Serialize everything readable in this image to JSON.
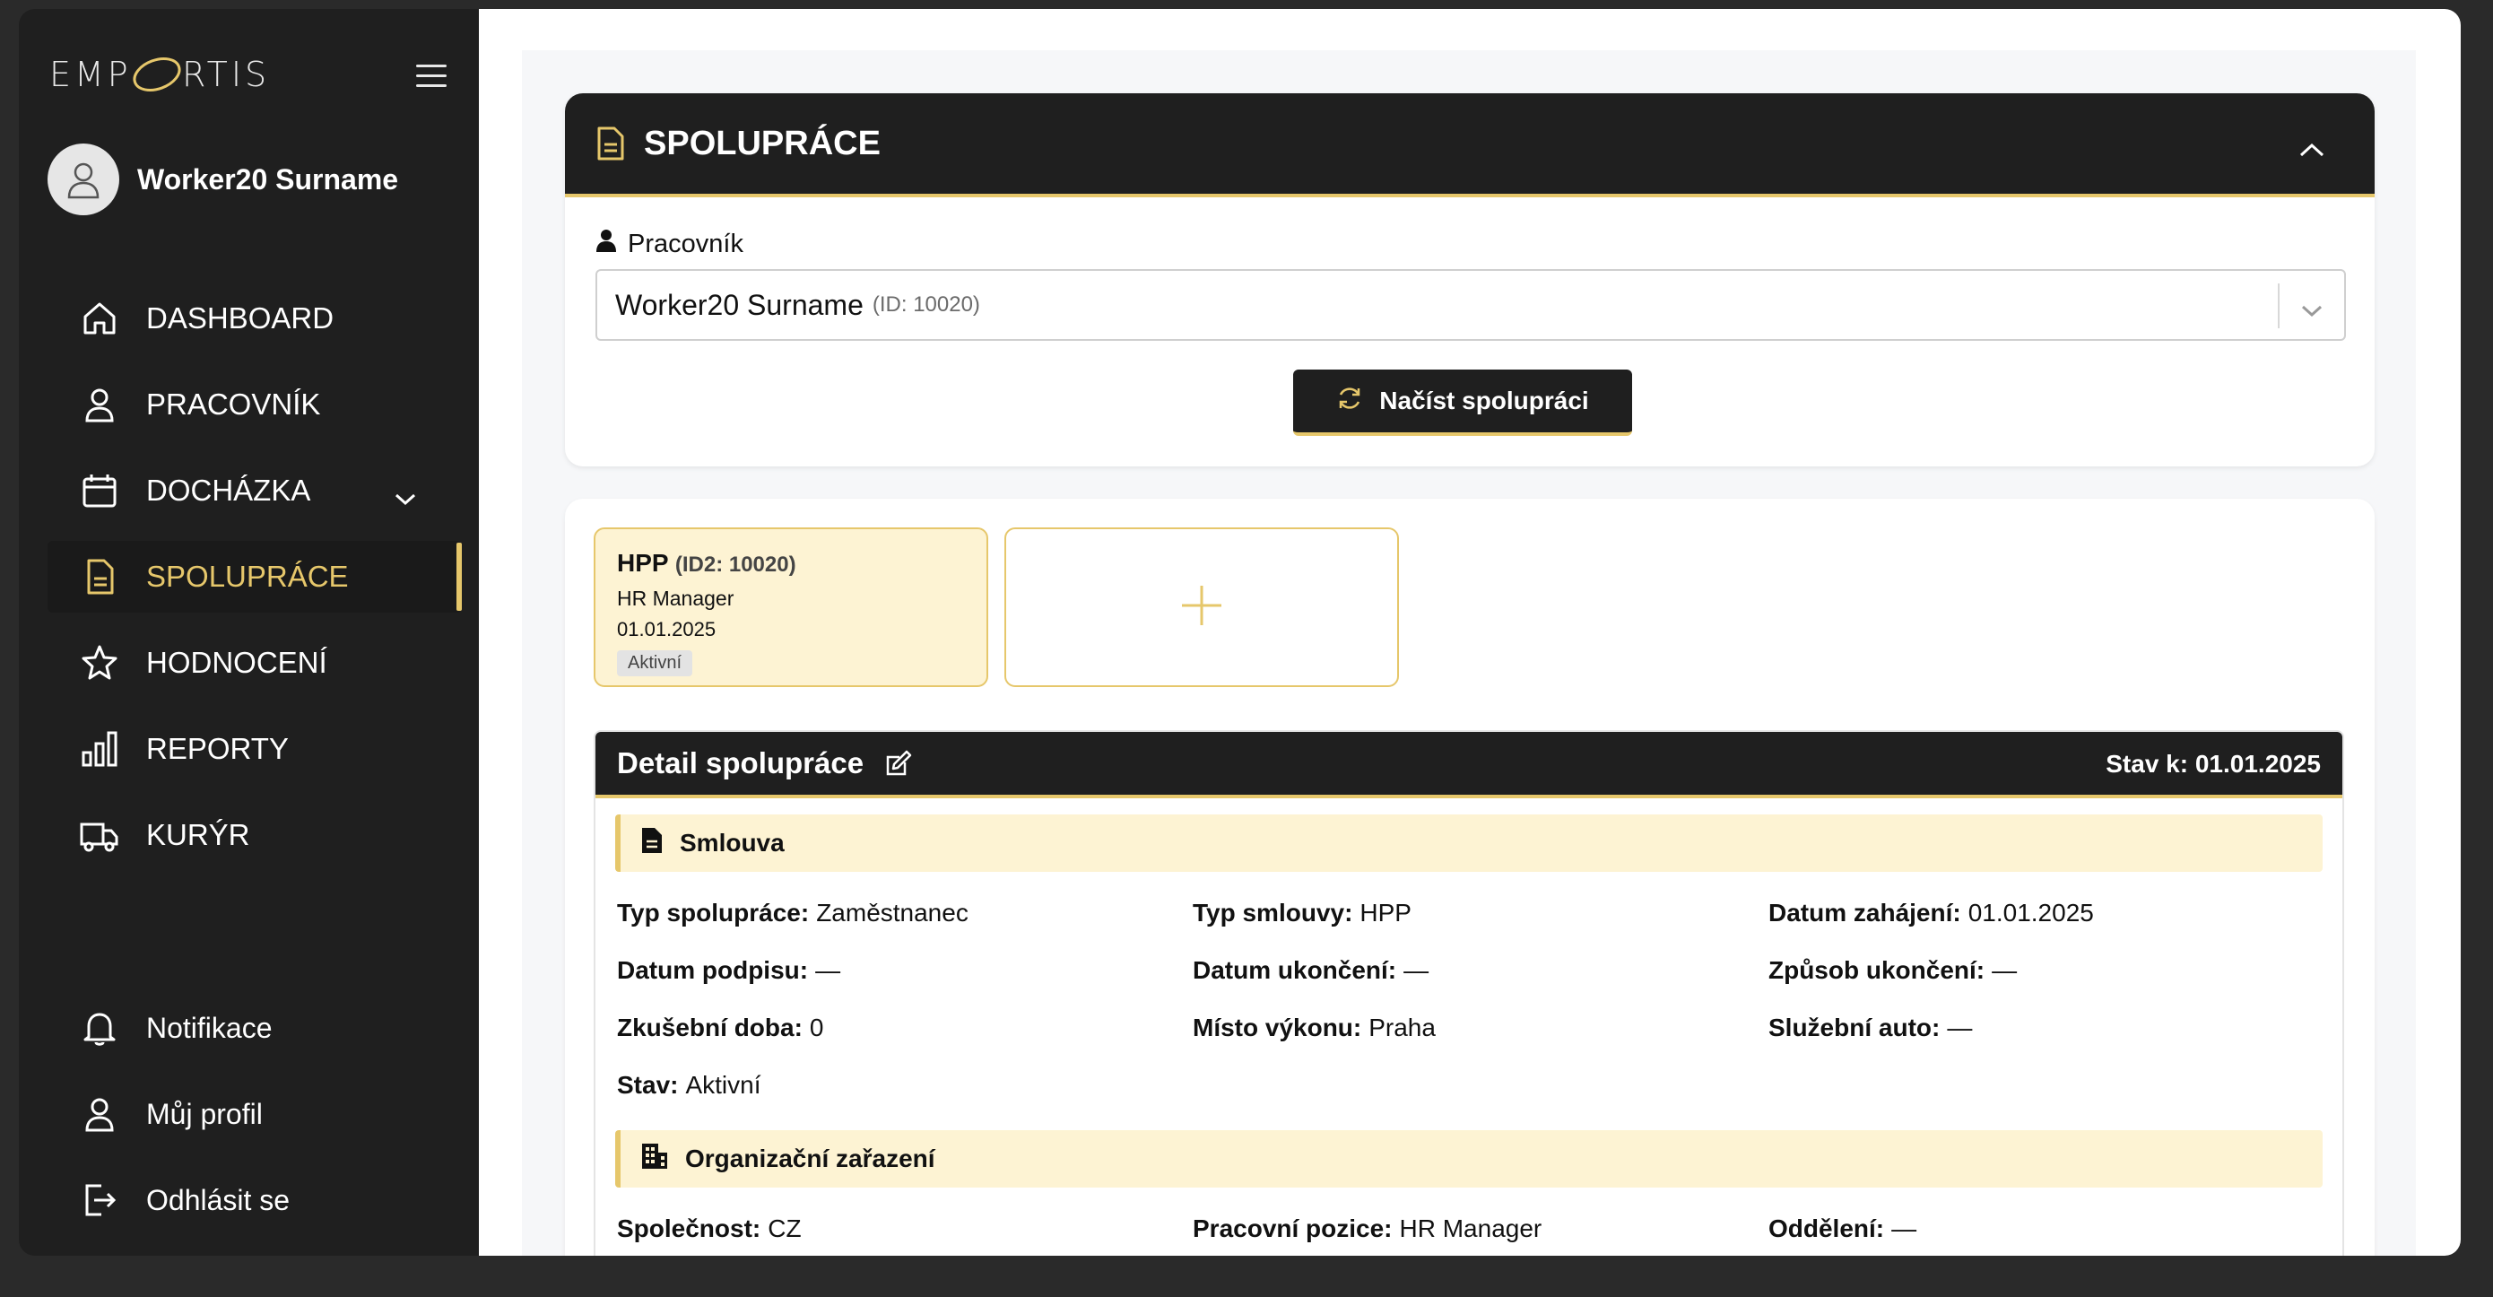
{
  "app": {
    "logo": "EMPORTIS",
    "user_name": "Worker20 Surname"
  },
  "nav": {
    "items": [
      {
        "label": "DASHBOARD"
      },
      {
        "label": "PRACOVNÍK"
      },
      {
        "label": "DOCHÁZKA"
      },
      {
        "label": "SPOLUPRÁCE"
      },
      {
        "label": "HODNOCENÍ"
      },
      {
        "label": "REPORTY"
      },
      {
        "label": "KURÝR"
      }
    ],
    "bottom": [
      {
        "label": "Notifikace"
      },
      {
        "label": "Můj profil"
      },
      {
        "label": "Odhlásit se"
      }
    ]
  },
  "colors": {
    "accent": "#e6c76b",
    "dark": "#1f1f1f",
    "accent_light": "#fdf3d3"
  },
  "header": {
    "title": "SPOLUPRÁCE"
  },
  "worker": {
    "label": "Pracovník",
    "selected": "Worker20 Surname",
    "selected_id": "(ID: 10020)",
    "load_button": "Načíst spolupráci"
  },
  "contracts": [
    {
      "type": "HPP",
      "id": "(ID2: 10020)",
      "position": "HR Manager",
      "date": "01.01.2025",
      "status": "Aktivní"
    }
  ],
  "detail": {
    "title": "Detail spolupráce",
    "state_label": "Stav k: 01.01.2025",
    "sections": [
      {
        "title": "Smlouva",
        "fields": [
          {
            "label": "Typ spolupráce:",
            "value": "Zaměstnanec"
          },
          {
            "label": "Typ smlouvy:",
            "value": "HPP"
          },
          {
            "label": "Datum zahájení:",
            "value": "01.01.2025"
          },
          {
            "label": "Datum podpisu:",
            "value": "—"
          },
          {
            "label": "Datum ukončení:",
            "value": "—"
          },
          {
            "label": "Způsob ukončení:",
            "value": "—"
          },
          {
            "label": "Zkušební doba:",
            "value": "0"
          },
          {
            "label": "Místo výkonu:",
            "value": "Praha"
          },
          {
            "label": "Služební auto:",
            "value": "—"
          },
          {
            "label": "Stav:",
            "value": "Aktivní"
          }
        ]
      },
      {
        "title": "Organizační zařazení",
        "fields": [
          {
            "label": "Společnost:",
            "value": "CZ"
          },
          {
            "label": "Pracovní pozice:",
            "value": "HR Manager"
          },
          {
            "label": "Oddělení:",
            "value": "—"
          }
        ]
      }
    ]
  }
}
